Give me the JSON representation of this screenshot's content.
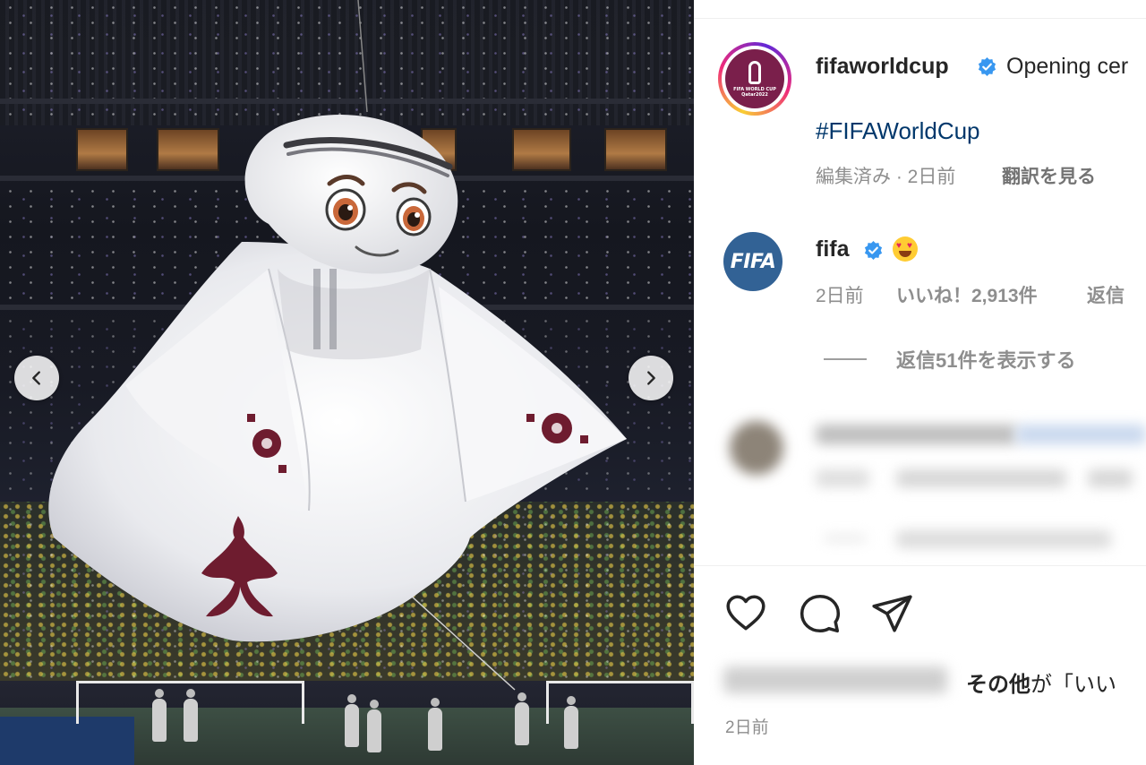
{
  "post": {
    "author": "fifaworldcup",
    "caption_visible": "Opening cer",
    "hashtag": "#FIFAWorldCup",
    "edited_time": "編集済み · 2日前",
    "translate_label": "翻訳を見る",
    "avatar_logo_text": [
      "FIFA WORLD CUP",
      "Qatar2022"
    ]
  },
  "comment": {
    "author": "fifa",
    "avatar_text": "FIFA",
    "emoji": "heart-eyes-emoji",
    "time": "2日前",
    "likes": "いいね！2,913件",
    "reply_label": "返信",
    "view_replies": "返信51件を表示する"
  },
  "actions": {
    "like_icon": "heart-icon",
    "comment_icon": "comment-icon",
    "share_icon": "share-icon"
  },
  "likes_summary": {
    "others": "その他",
    "suffix": "が「いい"
  },
  "footer": {
    "date": "2日前"
  },
  "colors": {
    "link": "#00376b",
    "verified": "#3897f0",
    "muted": "#8e8e8e",
    "fifa_blue": "#326295",
    "qatar_maroon": "#7a1f4b"
  }
}
